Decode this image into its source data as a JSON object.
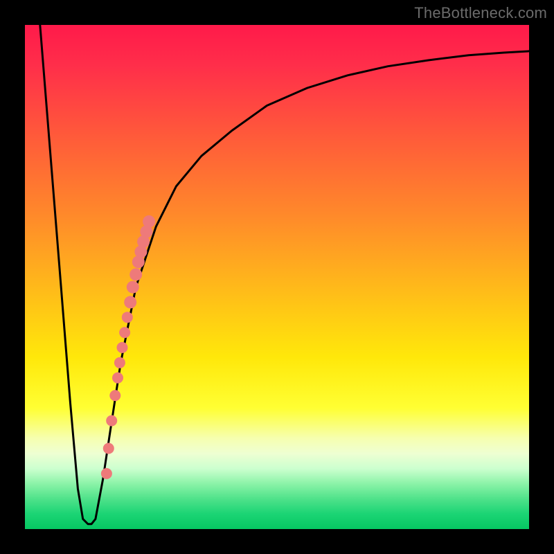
{
  "watermark": "TheBottleneck.com",
  "colors": {
    "curve": "#000000",
    "dots": "#ee7a7a",
    "dot_stroke": "#e86a6a"
  },
  "chart_data": {
    "type": "line",
    "title": "",
    "xlabel": "",
    "ylabel": "",
    "xlim": [
      0,
      100
    ],
    "ylim": [
      0,
      100
    ],
    "series": [
      {
        "name": "curve",
        "x": [
          3,
          5,
          7,
          9,
          10.5,
          11.5,
          12.5,
          13.2,
          14,
          15.5,
          17,
          19,
          22,
          26,
          30,
          35,
          41,
          48,
          56,
          64,
          72,
          80,
          88,
          95,
          100
        ],
        "y": [
          100,
          75,
          50,
          25,
          8,
          2,
          1,
          1,
          2,
          10,
          20,
          33,
          48,
          60,
          68,
          74,
          79,
          84,
          87.5,
          90,
          91.8,
          93,
          94,
          94.5,
          94.8
        ]
      }
    ],
    "dots": {
      "name": "highlight-dots",
      "x": [
        16.2,
        16.6,
        17.2,
        17.9,
        18.4,
        18.8,
        19.3,
        19.8,
        20.3,
        20.9,
        21.4,
        22.0,
        22.5,
        23.0,
        23.5,
        24.1,
        24.6
      ],
      "y": [
        11,
        16,
        21.5,
        26.5,
        30,
        33,
        36,
        39,
        42,
        45,
        48,
        50.5,
        53,
        55,
        57,
        59,
        61
      ]
    }
  }
}
